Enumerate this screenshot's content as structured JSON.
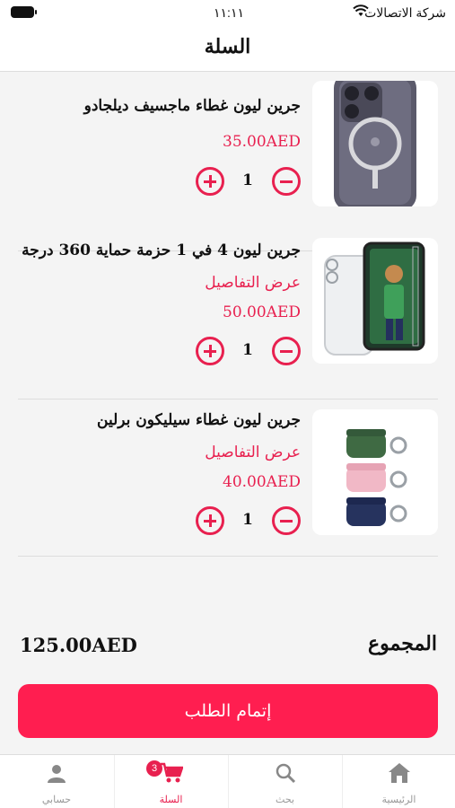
{
  "status_bar": {
    "carrier": "شركة الاتصالات",
    "time": "١١:١١ ص"
  },
  "header": {
    "title": "السلة"
  },
  "cart": {
    "items": [
      {
        "name": "جرين ليون غطاء ماجسيف ديلجادو",
        "details_label": "",
        "price": "35.00AED",
        "quantity": "1",
        "image_icon": "phone-case-magsafe"
      },
      {
        "name": "جرين ليون 4 في 1 حزمة حماية 360 درجة",
        "details_label": "عرض التفاصيل",
        "price": "50.00AED",
        "quantity": "1",
        "image_icon": "protection-bundle"
      },
      {
        "name": "جرين ليون غطاء سيليكون برلين",
        "details_label": "عرض التفاصيل",
        "price": "40.00AED",
        "quantity": "1",
        "image_icon": "airpods-silicone-cases"
      }
    ]
  },
  "summary": {
    "total_label": "المجموع",
    "total_value": "125.00AED"
  },
  "checkout": {
    "label": "إتمام الطلب"
  },
  "tab_bar": {
    "home": "الرئيسية",
    "search": "بحث",
    "cart": "السلة",
    "cart_badge": "3",
    "account": "حسابي"
  },
  "colors": {
    "accent": "#e8204f",
    "checkout_button": "#ff1e50",
    "background": "#f4f4f4"
  }
}
